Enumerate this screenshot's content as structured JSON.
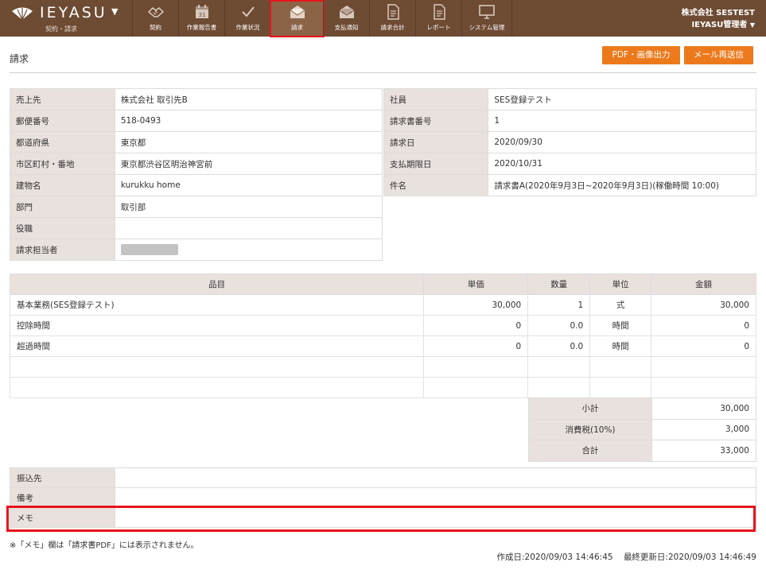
{
  "header": {
    "brand_name": "IEYASU",
    "brand_sub": "契約・請求",
    "nav": [
      {
        "label": "契約",
        "icon": "handshake-icon"
      },
      {
        "label": "作業報告書",
        "icon": "calendar-icon"
      },
      {
        "label": "作業状況",
        "icon": "checkmark-icon"
      },
      {
        "label": "請求",
        "icon": "envelope-money-icon"
      },
      {
        "label": "支払通知",
        "icon": "envelope-money-icon"
      },
      {
        "label": "請求合計",
        "icon": "document-icon"
      },
      {
        "label": "レポート",
        "icon": "document-icon"
      },
      {
        "label": "システム管理",
        "icon": "monitor-icon"
      }
    ],
    "company": "株式会社 SESTEST",
    "user": "IEYASU管理者"
  },
  "page": {
    "title": "請求",
    "pdf_button": "PDF・画像出力",
    "mail_button": "メール再送信"
  },
  "customer": [
    {
      "label": "売上先",
      "value": "株式会社 取引先B"
    },
    {
      "label": "郵便番号",
      "value": "518-0493"
    },
    {
      "label": "都道府県",
      "value": "東京都"
    },
    {
      "label": "市区町村・番地",
      "value": "東京都渋谷区明治神宮前"
    },
    {
      "label": "建物名",
      "value": "kurukku home"
    },
    {
      "label": "部門",
      "value": "取引部"
    },
    {
      "label": "役職",
      "value": ""
    },
    {
      "label": "請求担当者",
      "value": ""
    }
  ],
  "invoice": [
    {
      "label": "社員",
      "value": "SES登録テスト"
    },
    {
      "label": "請求書番号",
      "value": "1"
    },
    {
      "label": "請求日",
      "value": "2020/09/30"
    },
    {
      "label": "支払期限日",
      "value": "2020/10/31"
    },
    {
      "label": "件名",
      "value": "請求書A(2020年9月3日~2020年9月3日)(稼働時間 10:00)"
    }
  ],
  "items": {
    "headers": [
      "品目",
      "単価",
      "数量",
      "単位",
      "金額"
    ],
    "rows": [
      [
        "基本業務(SES登録テスト)",
        "30,000",
        "1",
        "式",
        "30,000"
      ],
      [
        "控除時間",
        "0",
        "0.0",
        "時間",
        "0"
      ],
      [
        "超過時間",
        "0",
        "0.0",
        "時間",
        "0"
      ],
      [
        "",
        "",
        "",
        "",
        ""
      ],
      [
        "",
        "",
        "",
        "",
        ""
      ]
    ]
  },
  "totals": [
    {
      "label": "小計",
      "value": "30,000"
    },
    {
      "label": "消費税(10%)",
      "value": "3,000"
    },
    {
      "label": "合計",
      "value": "33,000"
    }
  ],
  "memo": [
    {
      "label": "振込先",
      "value": ""
    },
    {
      "label": "備考",
      "value": ""
    },
    {
      "label": "メモ",
      "value": ""
    }
  ],
  "footer": {
    "note": "※「メモ」欄は「請求書PDF」には表示されません。",
    "created": "作成日:2020/09/03 14:46:45",
    "updated": "最終更新日:2020/09/03 14:46:49"
  },
  "colors": {
    "header_bg": "#6e4b33",
    "accent_button": "#ec7a1c",
    "highlight": "#e8141b",
    "label_bg": "#e9e1de"
  }
}
